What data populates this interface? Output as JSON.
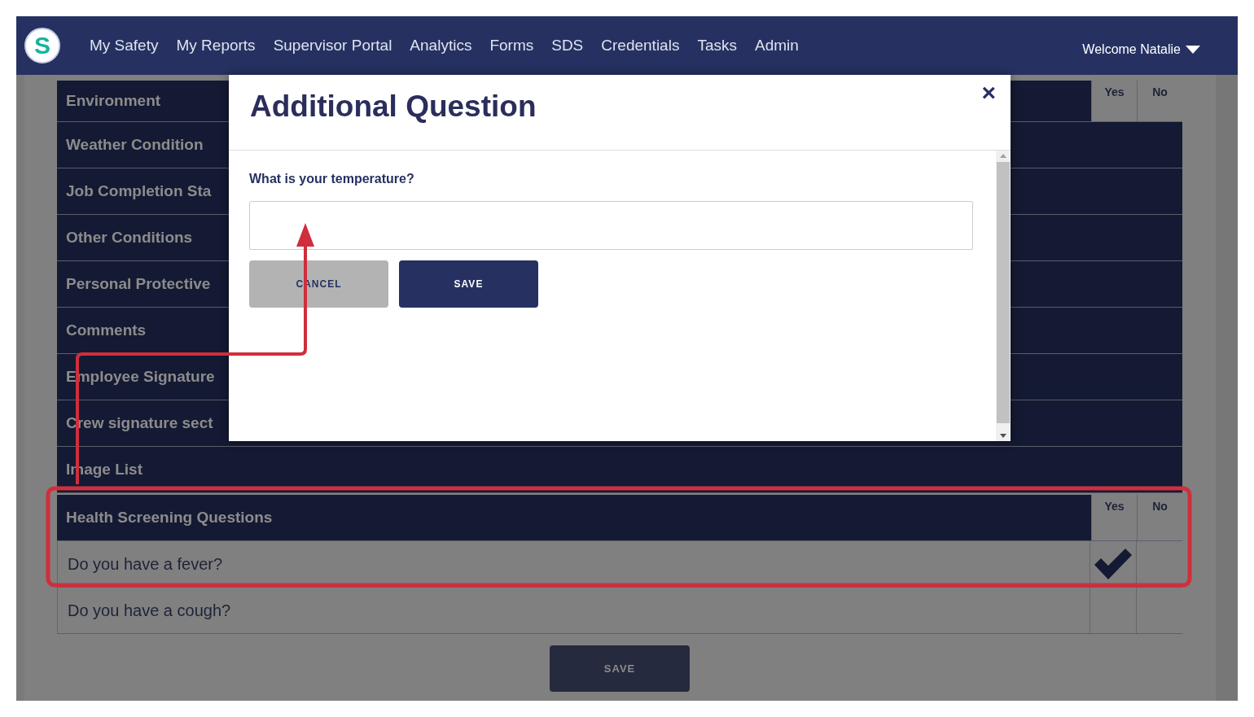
{
  "nav": {
    "logo": "S",
    "items": [
      "My Safety",
      "My Reports",
      "Supervisor Portal",
      "Analytics",
      "Forms",
      "SDS",
      "Credentials",
      "Tasks",
      "Admin"
    ],
    "user_menu": "Welcome Natalie"
  },
  "sections": [
    {
      "title": "Environment",
      "columns": [
        "Yes",
        "No"
      ]
    },
    {
      "title": "Weather Condition"
    },
    {
      "title": "Job Completion Sta"
    },
    {
      "title": "Other Conditions"
    },
    {
      "title": "Personal Protective"
    },
    {
      "title": "Comments"
    },
    {
      "title": "Employee Signature"
    },
    {
      "title": "Crew signature sect"
    },
    {
      "title": "Image List"
    },
    {
      "title": "Health Screening Questions",
      "columns": [
        "Yes",
        "No"
      ],
      "questions": [
        {
          "text": "Do you have a fever?",
          "yes_checked": true,
          "no_checked": false
        },
        {
          "text": "Do you have a cough?",
          "yes_checked": false,
          "no_checked": false
        }
      ]
    }
  ],
  "save_button": "SAVE",
  "modal": {
    "title": "Additional Question",
    "close": "×",
    "question": "What is your temperature?",
    "buttons": [
      {
        "label": "CANCEL",
        "kind": "secondary"
      },
      {
        "label": "SAVE",
        "kind": "primary"
      }
    ]
  },
  "annotations": {
    "highlight_frame": true,
    "leader_arrow": true
  }
}
